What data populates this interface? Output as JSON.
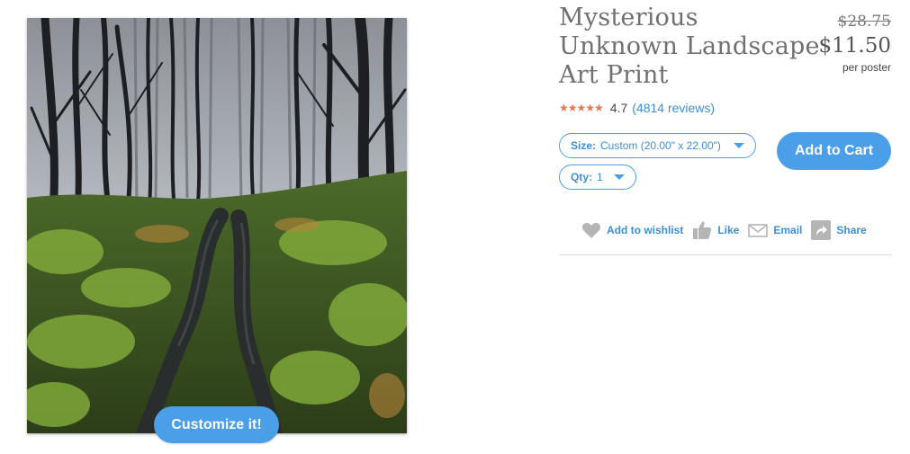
{
  "product": {
    "title": "Mysterious Unknown Landscape Art Print",
    "old_price": "$28.75",
    "price": "$11.50",
    "price_unit": "per poster"
  },
  "rating": {
    "stars_icon": "★★★★★",
    "value": "4.7",
    "reviews_text": "(4814 reviews)",
    "star_color": "#e07a55"
  },
  "options": {
    "size_label": "Size:",
    "size_value": "Custom (20.00\" x 22.00\")",
    "qty_label": "Qty:",
    "qty_value": "1"
  },
  "buttons": {
    "add_to_cart": "Add to Cart",
    "customize": "Customize it!"
  },
  "actions": {
    "wishlist": "Add to wishlist",
    "like": "Like",
    "email": "Email",
    "share": "Share"
  },
  "colors": {
    "accent": "#4a9fe8",
    "link": "#3b8fd8"
  },
  "icons": [
    "heart-icon",
    "thumbs-up-icon",
    "envelope-icon",
    "share-arrow-icon",
    "caret-down-icon",
    "star-icon"
  ]
}
